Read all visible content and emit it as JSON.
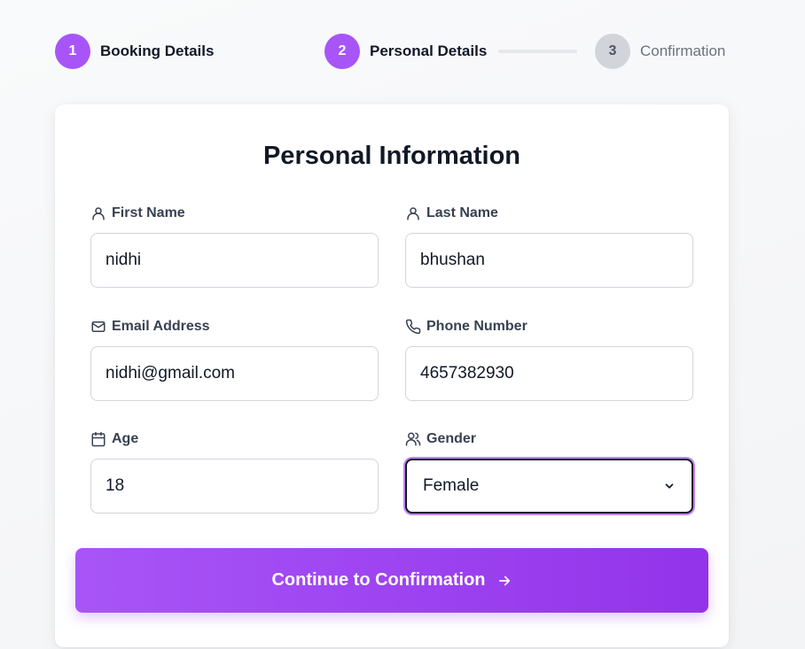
{
  "stepper": {
    "steps": [
      {
        "number": "1",
        "label": "Booking Details",
        "state": "complete"
      },
      {
        "number": "2",
        "label": "Personal Details",
        "state": "active"
      },
      {
        "number": "3",
        "label": "Confirmation",
        "state": "pending"
      }
    ]
  },
  "form": {
    "title": "Personal Information",
    "first_name": {
      "label": "First Name",
      "value": "nidhi",
      "icon": "user-icon"
    },
    "last_name": {
      "label": "Last Name",
      "value": "bhushan",
      "icon": "user-icon"
    },
    "email": {
      "label": "Email Address",
      "value": "nidhi@gmail.com",
      "icon": "mail-icon"
    },
    "phone": {
      "label": "Phone Number",
      "value": "4657382930",
      "icon": "phone-icon"
    },
    "age": {
      "label": "Age",
      "value": "18",
      "icon": "calendar-icon"
    },
    "gender": {
      "label": "Gender",
      "value": "Female",
      "icon": "users-icon"
    },
    "submit_label": "Continue to Confirmation"
  },
  "colors": {
    "accent": "#a855f7",
    "accent_dark": "#9333ea",
    "inactive_step": "#d1d5db"
  }
}
